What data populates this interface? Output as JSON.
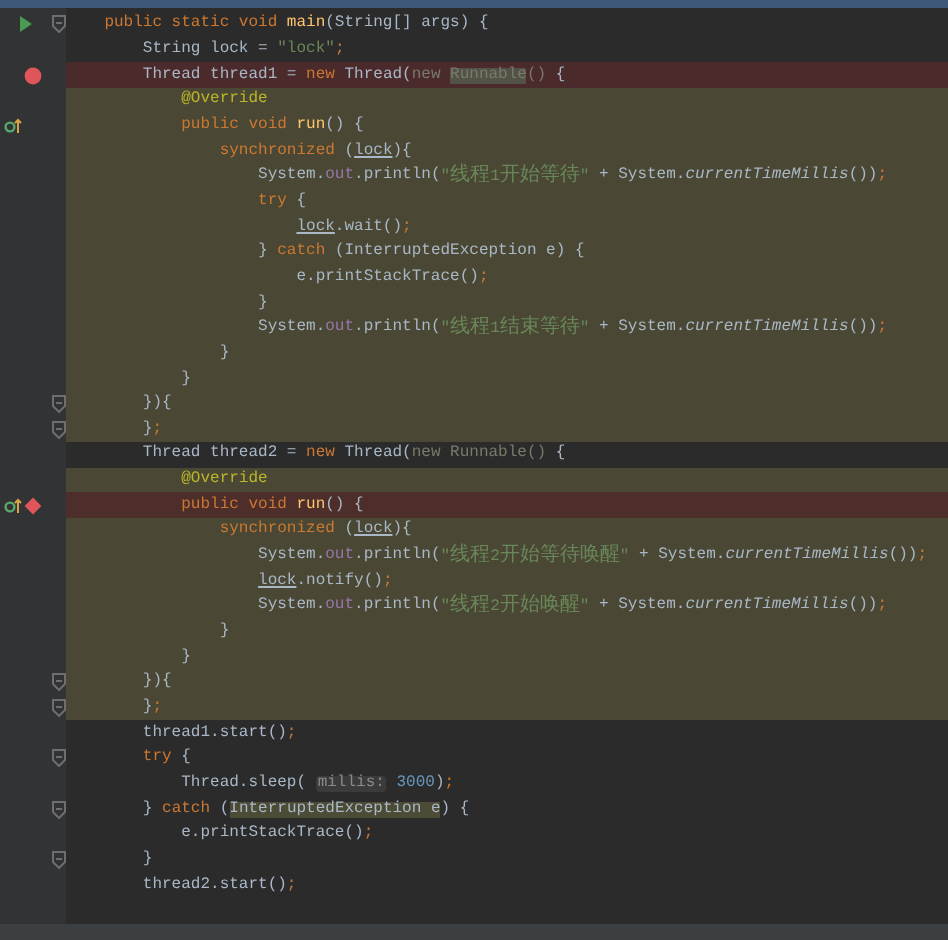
{
  "editor": {
    "lines": [
      {
        "breakpoint": false,
        "scope": false,
        "gutter_icons": [
          {
            "kind": "run"
          },
          {
            "kind": "fold"
          }
        ],
        "tokens": [
          {
            "kind": "keyword",
            "text": "public static void "
          },
          {
            "kind": "method",
            "text": "main"
          },
          {
            "kind": "plain",
            "text": "(String[] args) {"
          }
        ]
      },
      {
        "breakpoint": false,
        "scope": false,
        "tokens": [
          {
            "kind": "plain",
            "text": "String lock = "
          },
          {
            "kind": "string",
            "text": "\"lock\""
          },
          {
            "kind": "keyword",
            "text": ";"
          }
        ]
      },
      {
        "breakpoint": true,
        "scope": false,
        "gutter_icons": [
          {
            "kind": "breakpoint"
          }
        ],
        "tokens": [
          {
            "kind": "plain",
            "text": "Thread thread1 = "
          },
          {
            "kind": "keyword",
            "text": "new "
          },
          {
            "kind": "plain",
            "text": "Thread("
          },
          {
            "kind": "muted",
            "text": "new "
          },
          {
            "kind": "muted-marked",
            "text": "Runnable"
          },
          {
            "kind": "muted",
            "text": "() "
          },
          {
            "kind": "plain",
            "text": "{"
          }
        ]
      },
      {
        "breakpoint": false,
        "scope": true,
        "tokens": [
          {
            "kind": "annotation",
            "text": "@Override"
          }
        ]
      },
      {
        "breakpoint": false,
        "scope": true,
        "gutter_icons": [
          {
            "kind": "override"
          }
        ],
        "tokens": [
          {
            "kind": "keyword",
            "text": "public void "
          },
          {
            "kind": "method",
            "text": "run"
          },
          {
            "kind": "plain",
            "text": "() {"
          }
        ]
      },
      {
        "breakpoint": false,
        "scope": true,
        "tokens": [
          {
            "kind": "keyword",
            "text": "synchronized "
          },
          {
            "kind": "plain",
            "text": "("
          },
          {
            "kind": "captured",
            "text": "lock"
          },
          {
            "kind": "plain",
            "text": "){"
          }
        ]
      },
      {
        "breakpoint": false,
        "scope": true,
        "tokens": [
          {
            "kind": "plain",
            "text": "System."
          },
          {
            "kind": "field",
            "text": "out"
          },
          {
            "kind": "plain",
            "text": ".println("
          },
          {
            "kind": "string",
            "text": "\"线程1开始等待\""
          },
          {
            "kind": "plain",
            "text": " + System."
          },
          {
            "kind": "static",
            "text": "currentTimeMillis"
          },
          {
            "kind": "plain",
            "text": "())"
          },
          {
            "kind": "keyword",
            "text": ";"
          }
        ]
      },
      {
        "breakpoint": false,
        "scope": true,
        "tokens": [
          {
            "kind": "keyword",
            "text": "try "
          },
          {
            "kind": "plain",
            "text": "{"
          }
        ]
      },
      {
        "breakpoint": false,
        "scope": true,
        "tokens": [
          {
            "kind": "captured",
            "text": "lock"
          },
          {
            "kind": "plain",
            "text": ".wait()"
          },
          {
            "kind": "keyword",
            "text": ";"
          }
        ]
      },
      {
        "breakpoint": false,
        "scope": true,
        "tokens": [
          {
            "kind": "plain",
            "text": "} "
          },
          {
            "kind": "keyword",
            "text": "catch "
          },
          {
            "kind": "plain",
            "text": "(InterruptedException e) {"
          }
        ]
      },
      {
        "breakpoint": false,
        "scope": true,
        "tokens": [
          {
            "kind": "plain",
            "text": "e.printStackTrace()"
          },
          {
            "kind": "keyword",
            "text": ";"
          }
        ]
      },
      {
        "breakpoint": false,
        "scope": true,
        "tokens": [
          {
            "kind": "plain",
            "text": "}"
          }
        ]
      },
      {
        "breakpoint": false,
        "scope": true,
        "tokens": [
          {
            "kind": "plain",
            "text": "System."
          },
          {
            "kind": "field",
            "text": "out"
          },
          {
            "kind": "plain",
            "text": ".println("
          },
          {
            "kind": "string",
            "text": "\"线程1结束等待\""
          },
          {
            "kind": "plain",
            "text": " + System."
          },
          {
            "kind": "static",
            "text": "currentTimeMillis"
          },
          {
            "kind": "plain",
            "text": "())"
          },
          {
            "kind": "keyword",
            "text": ";"
          }
        ]
      },
      {
        "breakpoint": false,
        "scope": true,
        "tokens": [
          {
            "kind": "plain",
            "text": "}"
          }
        ]
      },
      {
        "breakpoint": false,
        "scope": true,
        "tokens": [
          {
            "kind": "plain",
            "text": "}"
          }
        ]
      },
      {
        "breakpoint": false,
        "scope": true,
        "gutter_icons": [
          {
            "kind": "fold"
          }
        ],
        "tokens": [
          {
            "kind": "plain",
            "text": "}){"
          }
        ]
      },
      {
        "breakpoint": false,
        "scope": true,
        "gutter_icons": [
          {
            "kind": "fold"
          }
        ],
        "tokens": [
          {
            "kind": "plain",
            "text": "}"
          },
          {
            "kind": "keyword",
            "text": ";"
          }
        ]
      },
      {
        "breakpoint": false,
        "scope": false,
        "tokens": [
          {
            "kind": "plain",
            "text": "Thread thread2 = "
          },
          {
            "kind": "keyword",
            "text": "new "
          },
          {
            "kind": "plain",
            "text": "Thread("
          },
          {
            "kind": "muted",
            "text": "new Runnable() "
          },
          {
            "kind": "plain",
            "text": "{"
          }
        ]
      },
      {
        "breakpoint": false,
        "scope": true,
        "tokens": [
          {
            "kind": "annotation",
            "text": "@Override"
          }
        ]
      },
      {
        "breakpoint": true,
        "scope": true,
        "gutter_icons": [
          {
            "kind": "override"
          },
          {
            "kind": "breakpoint-diamond"
          }
        ],
        "tokens": [
          {
            "kind": "keyword",
            "text": "public void "
          },
          {
            "kind": "method",
            "text": "run"
          },
          {
            "kind": "plain",
            "text": "() {"
          }
        ]
      },
      {
        "breakpoint": false,
        "scope": true,
        "tokens": [
          {
            "kind": "keyword",
            "text": "synchronized "
          },
          {
            "kind": "plain",
            "text": "("
          },
          {
            "kind": "captured",
            "text": "lock"
          },
          {
            "kind": "plain",
            "text": "){"
          }
        ]
      },
      {
        "breakpoint": false,
        "scope": true,
        "tokens": [
          {
            "kind": "plain",
            "text": "System."
          },
          {
            "kind": "field",
            "text": "out"
          },
          {
            "kind": "plain",
            "text": ".println("
          },
          {
            "kind": "string",
            "text": "\"线程2开始等待唤醒\""
          },
          {
            "kind": "plain",
            "text": " + System."
          },
          {
            "kind": "static",
            "text": "currentTimeMillis"
          },
          {
            "kind": "plain",
            "text": "())"
          },
          {
            "kind": "keyword",
            "text": ";"
          }
        ]
      },
      {
        "breakpoint": false,
        "scope": true,
        "tokens": [
          {
            "kind": "captured",
            "text": "lock"
          },
          {
            "kind": "plain",
            "text": ".notify()"
          },
          {
            "kind": "keyword",
            "text": ";"
          }
        ]
      },
      {
        "breakpoint": false,
        "scope": true,
        "tokens": [
          {
            "kind": "plain",
            "text": "System."
          },
          {
            "kind": "field",
            "text": "out"
          },
          {
            "kind": "plain",
            "text": ".println("
          },
          {
            "kind": "string",
            "text": "\"线程2开始唤醒\""
          },
          {
            "kind": "plain",
            "text": " + System."
          },
          {
            "kind": "static",
            "text": "currentTimeMillis"
          },
          {
            "kind": "plain",
            "text": "())"
          },
          {
            "kind": "keyword",
            "text": ";"
          }
        ]
      },
      {
        "breakpoint": false,
        "scope": true,
        "tokens": [
          {
            "kind": "plain",
            "text": "}"
          }
        ]
      },
      {
        "breakpoint": false,
        "scope": true,
        "tokens": [
          {
            "kind": "plain",
            "text": "}"
          }
        ]
      },
      {
        "breakpoint": false,
        "scope": true,
        "gutter_icons": [
          {
            "kind": "fold"
          }
        ],
        "tokens": [
          {
            "kind": "plain",
            "text": "}){"
          }
        ]
      },
      {
        "breakpoint": false,
        "scope": true,
        "gutter_icons": [
          {
            "kind": "fold"
          }
        ],
        "tokens": [
          {
            "kind": "plain",
            "text": "}"
          },
          {
            "kind": "keyword",
            "text": ";"
          }
        ]
      },
      {
        "breakpoint": false,
        "scope": false,
        "tokens": [
          {
            "kind": "plain",
            "text": "thread1.start()"
          },
          {
            "kind": "keyword",
            "text": ";"
          }
        ]
      },
      {
        "breakpoint": false,
        "scope": false,
        "gutter_icons": [
          {
            "kind": "fold"
          }
        ],
        "tokens": [
          {
            "kind": "keyword",
            "text": "try "
          },
          {
            "kind": "plain",
            "text": "{"
          }
        ]
      },
      {
        "breakpoint": false,
        "scope": false,
        "tokens": [
          {
            "kind": "plain",
            "text": "Thread.sleep( "
          },
          {
            "kind": "hint",
            "text": "millis:"
          },
          {
            "kind": "number",
            "text": " 3000"
          },
          {
            "kind": "plain",
            "text": ")"
          },
          {
            "kind": "keyword",
            "text": ";"
          }
        ]
      },
      {
        "breakpoint": false,
        "scope": false,
        "gutter_icons": [
          {
            "kind": "fold"
          }
        ],
        "tokens": [
          {
            "kind": "plain",
            "text": "} "
          },
          {
            "kind": "keyword",
            "text": "catch "
          },
          {
            "kind": "plain",
            "text": "("
          },
          {
            "kind": "plain-marked",
            "text": "InterruptedException e"
          },
          {
            "kind": "plain",
            "text": ") {"
          }
        ]
      },
      {
        "breakpoint": false,
        "scope": false,
        "tokens": [
          {
            "kind": "plain",
            "text": "e.printStackTrace()"
          },
          {
            "kind": "keyword",
            "text": ";"
          }
        ]
      },
      {
        "breakpoint": false,
        "scope": false,
        "gutter_icons": [
          {
            "kind": "fold"
          }
        ],
        "tokens": [
          {
            "kind": "plain",
            "text": "}"
          }
        ]
      },
      {
        "breakpoint": false,
        "scope": false,
        "tokens": [
          {
            "kind": "plain",
            "text": "thread2.start()"
          },
          {
            "kind": "keyword",
            "text": ";"
          }
        ]
      }
    ]
  }
}
